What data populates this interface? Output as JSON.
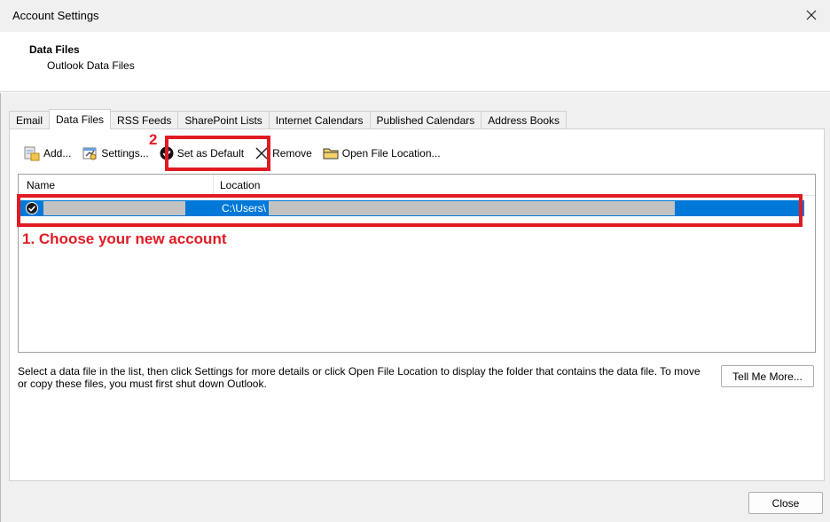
{
  "window": {
    "title": "Account Settings",
    "close_glyph": "✕"
  },
  "header": {
    "title": "Data Files",
    "subtitle": "Outlook Data Files"
  },
  "tabs": [
    {
      "label": "Email",
      "active": false
    },
    {
      "label": "Data Files",
      "active": true
    },
    {
      "label": "RSS Feeds",
      "active": false
    },
    {
      "label": "SharePoint Lists",
      "active": false
    },
    {
      "label": "Internet Calendars",
      "active": false
    },
    {
      "label": "Published Calendars",
      "active": false
    },
    {
      "label": "Address Books",
      "active": false
    }
  ],
  "toolbar": {
    "add": "Add...",
    "settings": "Settings...",
    "set_default": "Set as Default",
    "remove": "Remove",
    "open_location": "Open File Location..."
  },
  "list": {
    "columns": [
      "Name",
      "Location"
    ],
    "rows": [
      {
        "location": "C:\\Users\\"
      }
    ]
  },
  "annotations": {
    "step1": "1. Choose your new account",
    "step2": "2",
    "color": "#e01b24"
  },
  "description": "Select a data file in the list, then click Settings for more details or click Open File Location to display the folder that contains the data file. To move or copy these files, you must first shut down Outlook.",
  "buttons": {
    "tell_me_more": "Tell Me More...",
    "close": "Close"
  },
  "colors": {
    "selection": "#0078d7",
    "accent_red": "#e01b24"
  }
}
